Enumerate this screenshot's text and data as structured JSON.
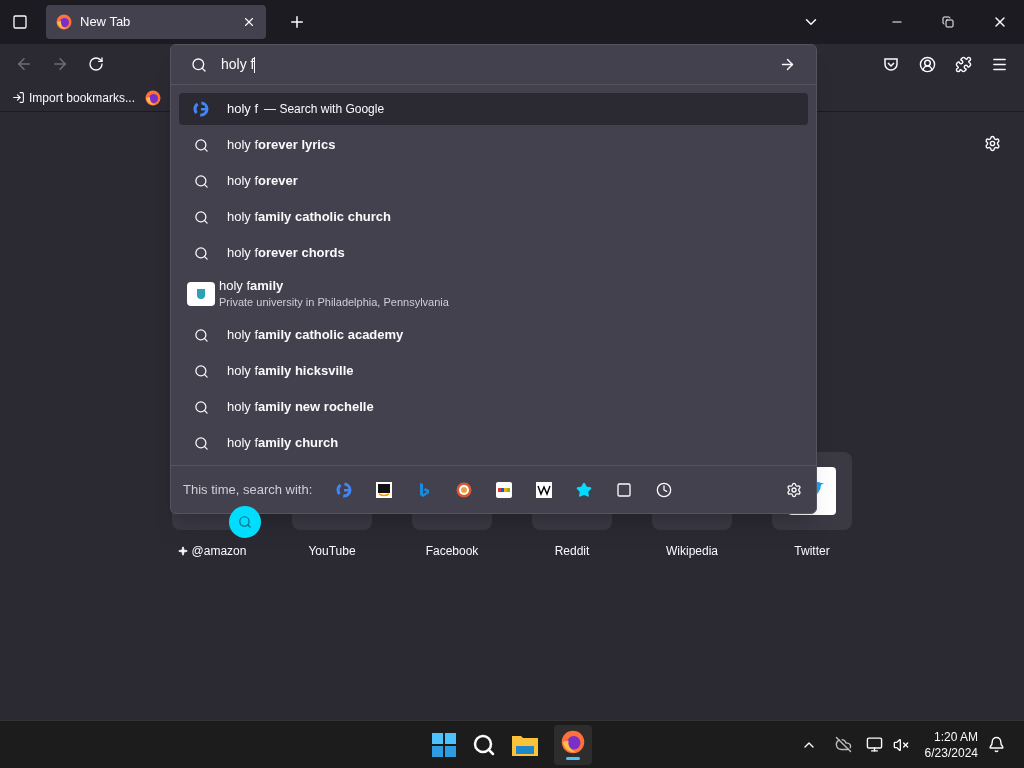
{
  "tab": {
    "title": "New Tab",
    "selected": true
  },
  "nav": {
    "back": {
      "disabled": true
    },
    "forward": {
      "disabled": true
    }
  },
  "bookmarks": [
    {
      "label": "Import bookmarks..."
    }
  ],
  "urlbar": {
    "value": "holy f"
  },
  "suggestions": [
    {
      "kind": "engine",
      "text": "holy f",
      "note": "— Search with Google",
      "selected": true
    },
    {
      "kind": "search",
      "text": "holy f**orever lyrics**",
      "selected": false
    },
    {
      "kind": "search",
      "text": "holy f**orever**",
      "selected": false
    },
    {
      "kind": "search",
      "text": "holy f**amily catholic church**",
      "selected": false
    },
    {
      "kind": "search",
      "text": "holy f**orever chords**",
      "selected": false
    },
    {
      "kind": "entity",
      "text": "holy f**amily**",
      "description": "Private university in Philadelphia, Pennsylvania",
      "selected": false
    },
    {
      "kind": "search",
      "text": "holy f**amily catholic academy**",
      "selected": false
    },
    {
      "kind": "search",
      "text": "holy f**amily hicksville**",
      "selected": false
    },
    {
      "kind": "search",
      "text": "holy f**amily new rochelle**",
      "selected": false
    },
    {
      "kind": "search",
      "text": "holy f**amily church**",
      "selected": false
    }
  ],
  "search_with": {
    "label": "This time, search with:"
  },
  "shortcuts": [
    {
      "label": "@amazon",
      "sponsored": true
    },
    {
      "label": "YouTube",
      "sponsored": false
    },
    {
      "label": "Facebook",
      "sponsored": false
    },
    {
      "label": "Reddit",
      "sponsored": false
    },
    {
      "label": "Wikipedia",
      "sponsored": false
    },
    {
      "label": "Twitter",
      "sponsored": false
    }
  ],
  "taskbar": {
    "time": "1:20 AM",
    "date": "6/23/2024"
  }
}
